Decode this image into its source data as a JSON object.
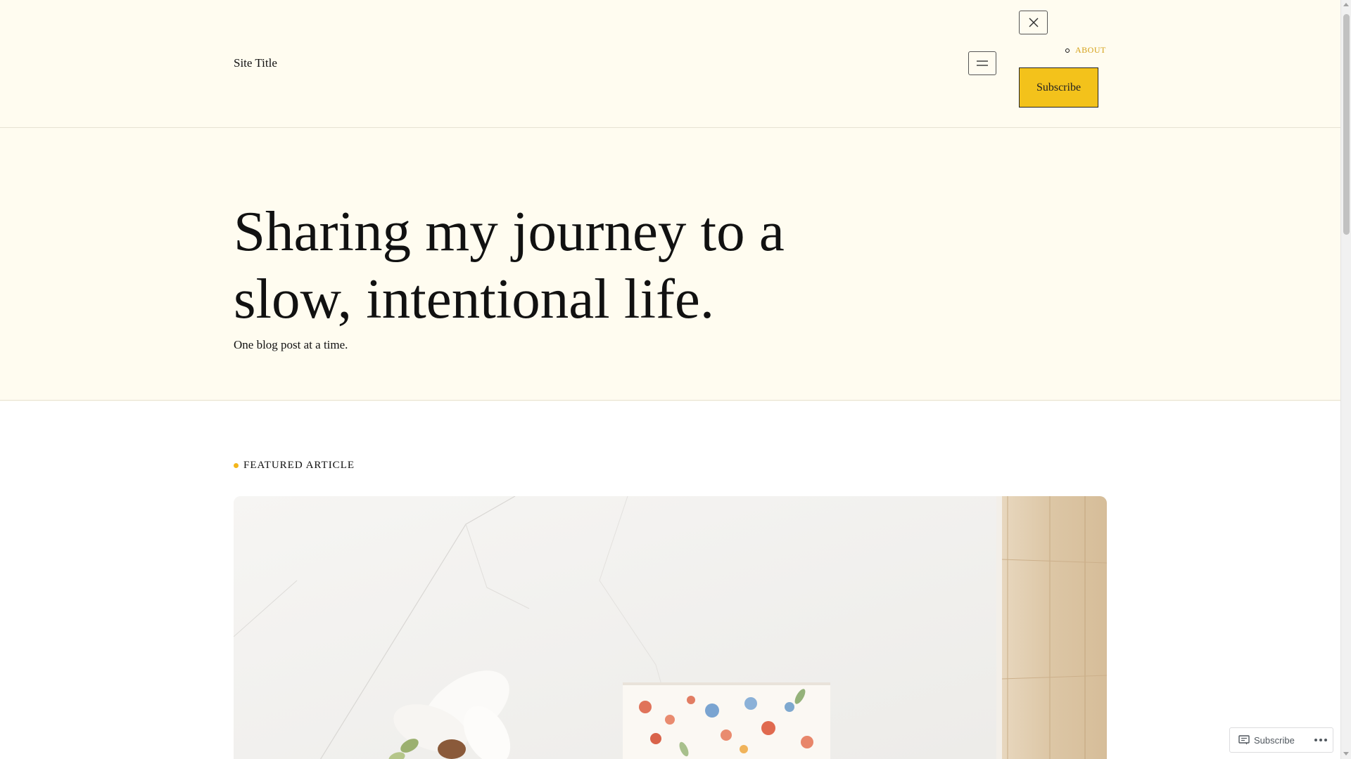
{
  "header": {
    "site_title": "Site Title",
    "nav_items": [
      {
        "label": "ABOUT"
      }
    ],
    "subscribe_label": "Subscribe"
  },
  "hero": {
    "title": "Sharing my journey to a slow, intentional life.",
    "subtitle": "One blog post at a time."
  },
  "featured": {
    "label": "FEATURED ARTICLE"
  },
  "floating_bar": {
    "subscribe_label": "Subscribe"
  },
  "colors": {
    "background": "#fffcf0",
    "accent": "#f3c21b",
    "link": "#d4a017"
  },
  "icons": [
    "close-icon",
    "menu-icon",
    "reader-icon",
    "more-icon"
  ]
}
